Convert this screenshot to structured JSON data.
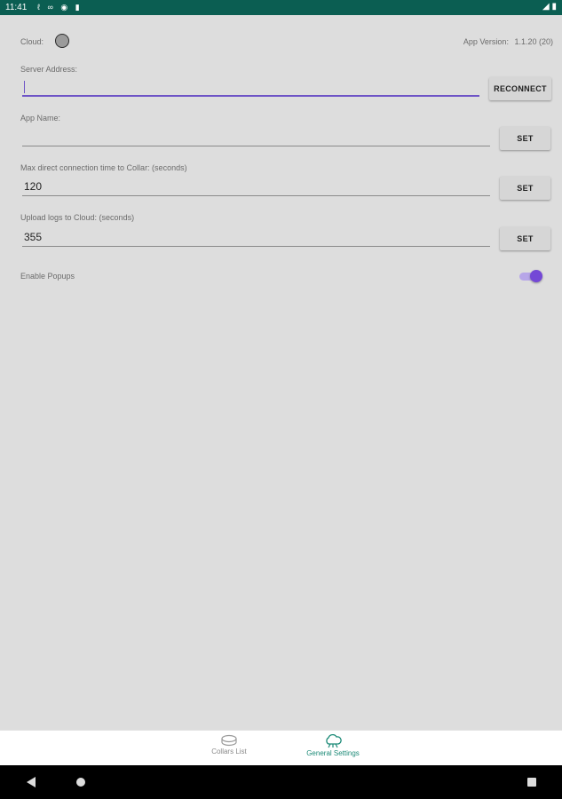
{
  "status_bar": {
    "time": "11:41",
    "icons": [
      "notification-icon",
      "voicemail-icon",
      "app-icon",
      "sd-card-icon"
    ],
    "right_icons": [
      "wifi-icon",
      "battery-icon"
    ]
  },
  "settings": {
    "cloud_label": "Cloud:",
    "cloud_status_color": "#9b9b9b",
    "app_version_label": "App Version:",
    "app_version_value": "1.1.20 (20)",
    "server_address_label": "Server Address:",
    "server_address_value": "",
    "reconnect_label": "RECONNECT",
    "app_name_label": "App Name:",
    "app_name_value": "",
    "app_name_set": "SET",
    "max_conn_label": "Max direct connection time to Collar: (seconds)",
    "max_conn_value": "120",
    "max_conn_set": "SET",
    "upload_logs_label": "Upload logs to Cloud: (seconds)",
    "upload_logs_value": "355",
    "upload_logs_set": "SET",
    "enable_popups_label": "Enable Popups",
    "enable_popups_on": true
  },
  "bottom_nav": {
    "items": [
      {
        "label": "Collars List",
        "icon": "collar-icon",
        "active": false
      },
      {
        "label": "General Settings",
        "icon": "cloud-settings-icon",
        "active": true
      }
    ]
  },
  "colors": {
    "status_bar": "#0b5e52",
    "accent": "#6e54c6",
    "nav_active": "#1c8a77"
  }
}
